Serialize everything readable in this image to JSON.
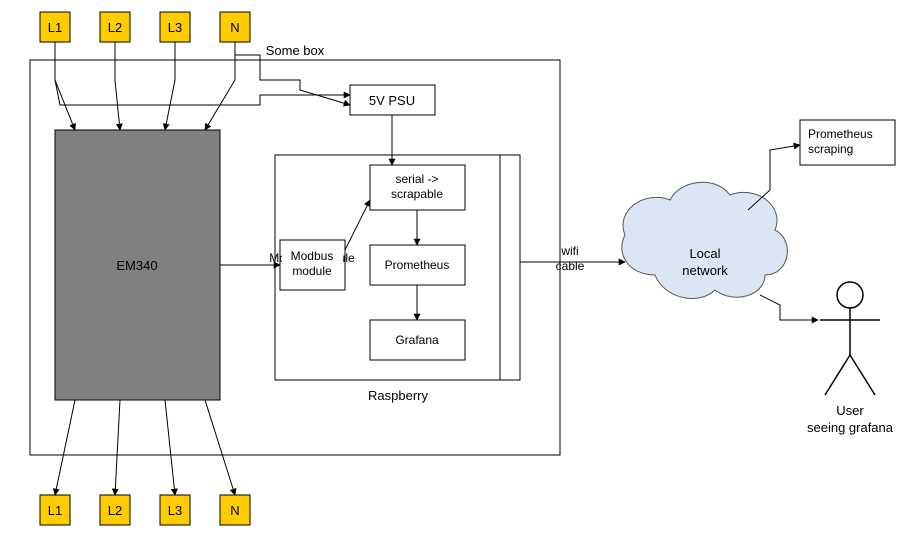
{
  "diagram": {
    "inputs_top": [
      "L1",
      "L2",
      "L3",
      "N"
    ],
    "outputs_bottom": [
      "L1",
      "L2",
      "L3",
      "N"
    ],
    "container_label": "Some box",
    "meter": "EM340",
    "psu": "5V PSU",
    "modbus": "Modbus module",
    "raspberry_label": "Raspberry",
    "raspberry": {
      "adapter_l1": "serial ->",
      "adapter_l2": "scrapable",
      "prometheus": "Prometheus",
      "grafana": "Grafana"
    },
    "link_label_l1": "wifi",
    "link_label_l2": "cable",
    "cloud_l1": "Local",
    "cloud_l2": "network",
    "scraper_l1": "Prometheus",
    "scraper_l2": "scraping",
    "user_l1": "User",
    "user_l2": "seeing grafana"
  }
}
